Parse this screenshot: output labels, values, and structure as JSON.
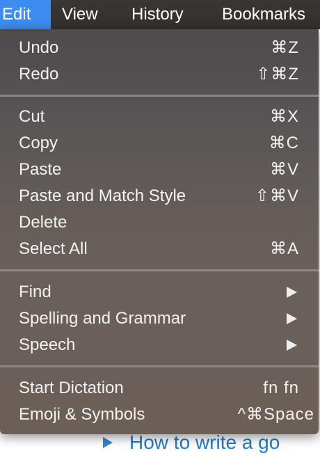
{
  "menubar": {
    "items": [
      {
        "label": "Edit",
        "active": true
      },
      {
        "label": "View"
      },
      {
        "label": "History"
      },
      {
        "label": "Bookmarks"
      }
    ]
  },
  "edit_menu": {
    "groups": [
      [
        {
          "label": "Undo",
          "shortcut": "⌘Z"
        },
        {
          "label": "Redo",
          "shortcut": "⇧⌘Z"
        }
      ],
      [
        {
          "label": "Cut",
          "shortcut": "⌘X"
        },
        {
          "label": "Copy",
          "shortcut": "⌘C"
        },
        {
          "label": "Paste",
          "shortcut": "⌘V"
        },
        {
          "label": "Paste and Match Style",
          "shortcut": "⇧⌘V"
        },
        {
          "label": "Delete",
          "shortcut": ""
        },
        {
          "label": "Select All",
          "shortcut": "⌘A"
        }
      ],
      [
        {
          "label": "Find",
          "submenu": true
        },
        {
          "label": "Spelling and Grammar",
          "submenu": true
        },
        {
          "label": "Speech",
          "submenu": true
        }
      ],
      [
        {
          "label": "Start Dictation",
          "shortcut": "fn fn"
        },
        {
          "label": "Emoji & Symbols",
          "shortcut": "^⌘Space"
        }
      ]
    ]
  },
  "page": {
    "link_text": "How to write a go"
  },
  "colors": {
    "menubar_bg": "#363232",
    "active_highlight": "#3d8cf0",
    "link": "#1f7cc6"
  }
}
